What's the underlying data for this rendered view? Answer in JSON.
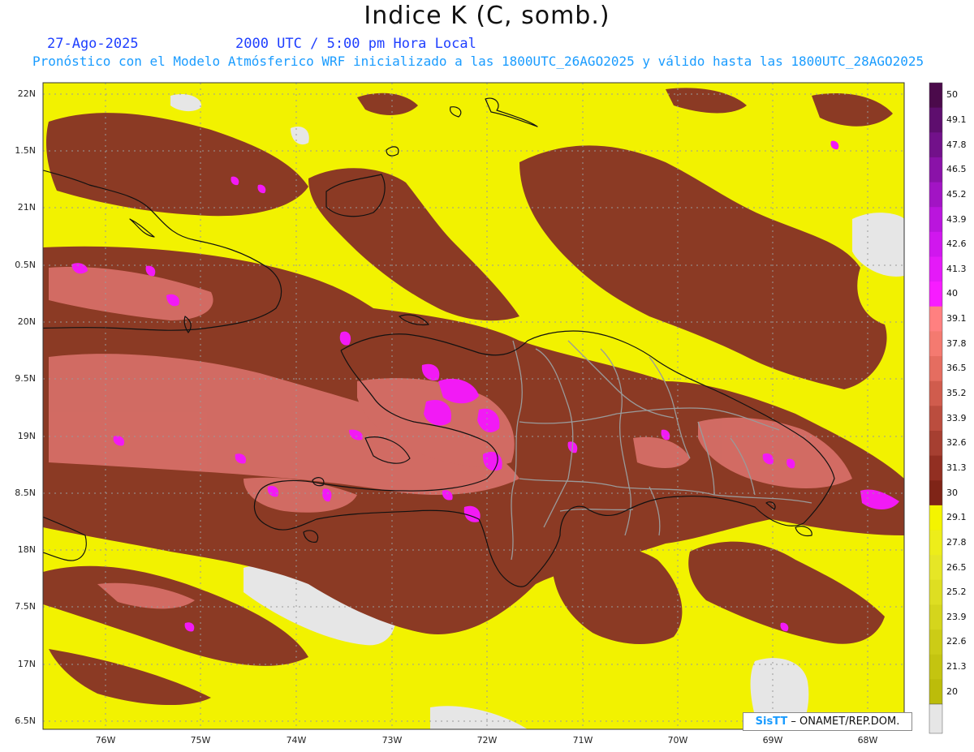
{
  "title": "Indice K (C, somb.)",
  "date": "27-Ago-2025",
  "time": "2000 UTC / 5:00 pm Hora Local",
  "forecast_line": "Pronóstico con el Modelo Atmósferico WRF inicializado a las 1800UTC_26AGO2025 y válido hasta las  1800UTC_28AGO2025",
  "credit": {
    "logo": "SisTT",
    "text": " – ONAMET/REP.DOM."
  },
  "lat_labels": [
    "22N",
    "1.5N",
    "21N",
    "0.5N",
    "20N",
    "9.5N",
    "19N",
    "8.5N",
    "18N",
    "7.5N",
    "17N",
    "6.5N"
  ],
  "lon_labels": [
    "76W",
    "75W",
    "74W",
    "73W",
    "72W",
    "71W",
    "70W",
    "69W",
    "68W"
  ],
  "colorbar": {
    "labels": [
      "50",
      "49.1",
      "47.8",
      "46.5",
      "45.2",
      "43.9",
      "42.6",
      "41.3",
      "40",
      "39.1",
      "37.8",
      "36.5",
      "35.2",
      "33.9",
      "32.6",
      "31.3",
      "30",
      "29.1",
      "27.8",
      "26.5",
      "25.2",
      "23.9",
      "22.6",
      "21.3",
      "20"
    ],
    "colors": [
      "#4b0a4b",
      "#5e0e6e",
      "#72118a",
      "#8a12a8",
      "#a214c4",
      "#ba15dd",
      "#d017ee",
      "#e41af8",
      "#f71cff",
      "#ff8080",
      "#f47a70",
      "#e56d60",
      "#d05c4d",
      "#bb4d3e",
      "#a63f31",
      "#922f22",
      "#7f2417",
      "#f4f400",
      "#eded1a",
      "#e6e626",
      "#dede22",
      "#d5d51c",
      "#cccc16",
      "#c4c410",
      "#bcbc0a"
    ],
    "below_color": "#e6e6e6"
  },
  "map_colors": {
    "yellow": "#f2f200",
    "brown": "#8b3a24",
    "salmon": "#d9716a",
    "magenta": "#f21af5",
    "gray": "#e6e6e6",
    "coast": "#111111",
    "provinces": "#9a9a9a"
  }
}
